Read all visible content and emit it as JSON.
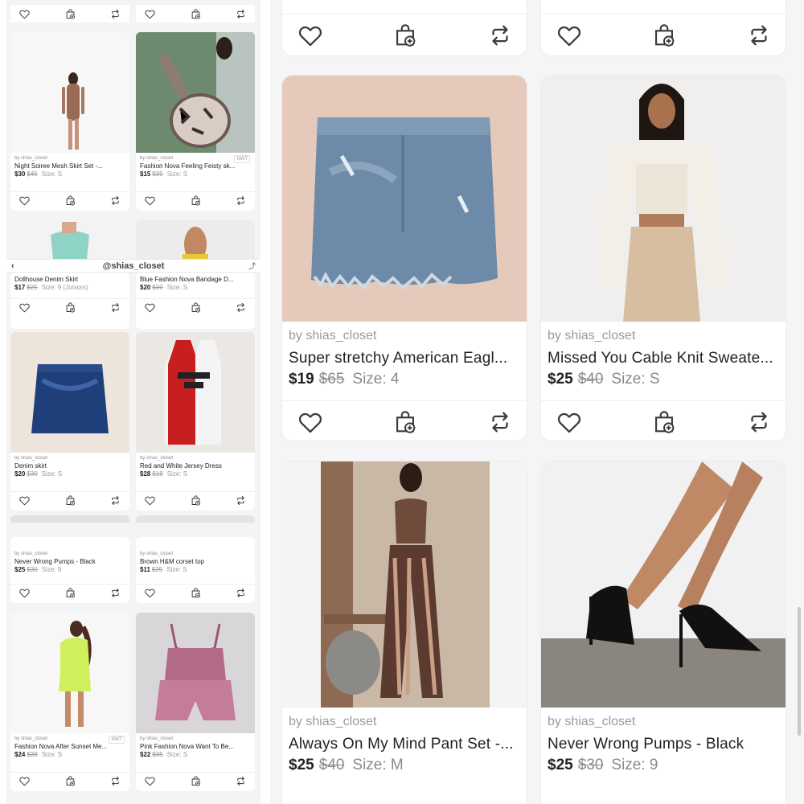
{
  "seller": "by shias_closet",
  "profile_handle": "@shias_closet",
  "colors": {
    "accent": "#222222",
    "muted": "#999999",
    "card_bg": "#ffffff",
    "page_bg": "#f5f4f6"
  },
  "left": {
    "seg_a": [
      {
        "title": "Night Soiree Mesh Skirt Set -...",
        "price": "$30",
        "original_price": "$45",
        "size": "Size: S",
        "tag": ""
      },
      {
        "title": "Fashion Nova Feeling Feisty sk...",
        "price": "$15",
        "original_price": "$35",
        "size": "Size: S",
        "tag": "NWT"
      }
    ],
    "seg_b_top": [
      {
        "title": "Dollhouse Denim Skirt",
        "price": "$17",
        "original_price": "$25",
        "size": "Size: 9 (Juniors)"
      },
      {
        "title": "Blue Fashion Nova Bandage D...",
        "price": "$20",
        "original_price": "$30",
        "size": "Size: S"
      }
    ],
    "seg_b": [
      {
        "title": "Denim skirt",
        "price": "$20",
        "original_price": "$30",
        "size": "Size: S"
      },
      {
        "title": "Red and White Jersey Dress",
        "price": "$28",
        "original_price": "$18",
        "size": "Size: S"
      }
    ],
    "seg_c_top": [
      {
        "title": "Never Wrong Pumps - Black",
        "price": "$25",
        "original_price": "$30",
        "size": "Size: 9"
      },
      {
        "title": "Brown H&M corset top",
        "price": "$11",
        "original_price": "$25",
        "size": "Size: S"
      }
    ],
    "seg_c": [
      {
        "title": "Fashion Nova After Sunset Me...",
        "price": "$24",
        "original_price": "$38",
        "size": "Size: S",
        "tag": "NWT"
      },
      {
        "title": "Pink Fashion Nova Want To Be...",
        "price": "$22",
        "original_price": "$35",
        "size": "Size: S",
        "tag": ""
      }
    ]
  },
  "right": {
    "items": [
      {
        "title": "Super stretchy American Eagl...",
        "price": "$19",
        "original_price": "$65",
        "size": "Size: 4"
      },
      {
        "title": "Missed You Cable Knit Sweate...",
        "price": "$25",
        "original_price": "$40",
        "size": "Size: S"
      },
      {
        "title": "Always On My Mind Pant Set -...",
        "price": "$25",
        "original_price": "$40",
        "size": "Size: M"
      },
      {
        "title": "Never Wrong Pumps - Black",
        "price": "$25",
        "original_price": "$30",
        "size": "Size: 9"
      }
    ]
  },
  "icons": {
    "like": "heart-icon",
    "bundle": "bag-plus-icon",
    "share": "repost-icon"
  }
}
